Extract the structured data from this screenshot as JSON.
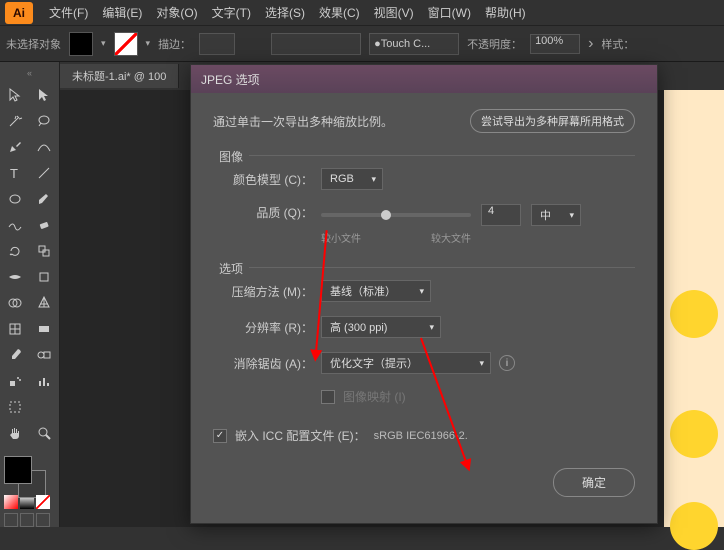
{
  "menu": {
    "items": [
      "文件(F)",
      "编辑(E)",
      "对象(O)",
      "文字(T)",
      "选择(S)",
      "效果(C)",
      "视图(V)",
      "窗口(W)",
      "帮助(H)"
    ]
  },
  "optbar": {
    "noSelection": "未选择对象",
    "stroke": "描边：",
    "touch": "Touch C...",
    "opacityLabel": "不透明度：",
    "opacityValue": "100%",
    "styleLabel": "样式："
  },
  "tab": {
    "title": "未标题-1.ai* @ 100"
  },
  "dialog": {
    "title": "JPEG 选项",
    "banner": "通过单击一次导出多种缩放比例。",
    "bannerBtn": "尝试导出为多种屏幕所用格式",
    "image": {
      "section": "图像",
      "colorModelLabel": "颜色模型 (C)：",
      "colorModelValue": "RGB",
      "qualityLabel": "品质 (Q)：",
      "qualityValue": "4",
      "qualityPreset": "中",
      "smallFile": "较小文件",
      "bigFile": "较大文件"
    },
    "options": {
      "section": "选项",
      "compressLabel": "压缩方法 (M)：",
      "compressValue": "基线（标准）",
      "resolutionLabel": "分辨率 (R)：",
      "resolutionValue": "高 (300 ppi)",
      "antialiasLabel": "消除锯齿 (A)：",
      "antialiasValue": "优化文字（提示）",
      "imageMap": "图像映射 (I)"
    },
    "icc": {
      "label": "嵌入 ICC 配置文件 (E)：",
      "value": "sRGB IEC61966-2."
    },
    "ok": "确定"
  }
}
